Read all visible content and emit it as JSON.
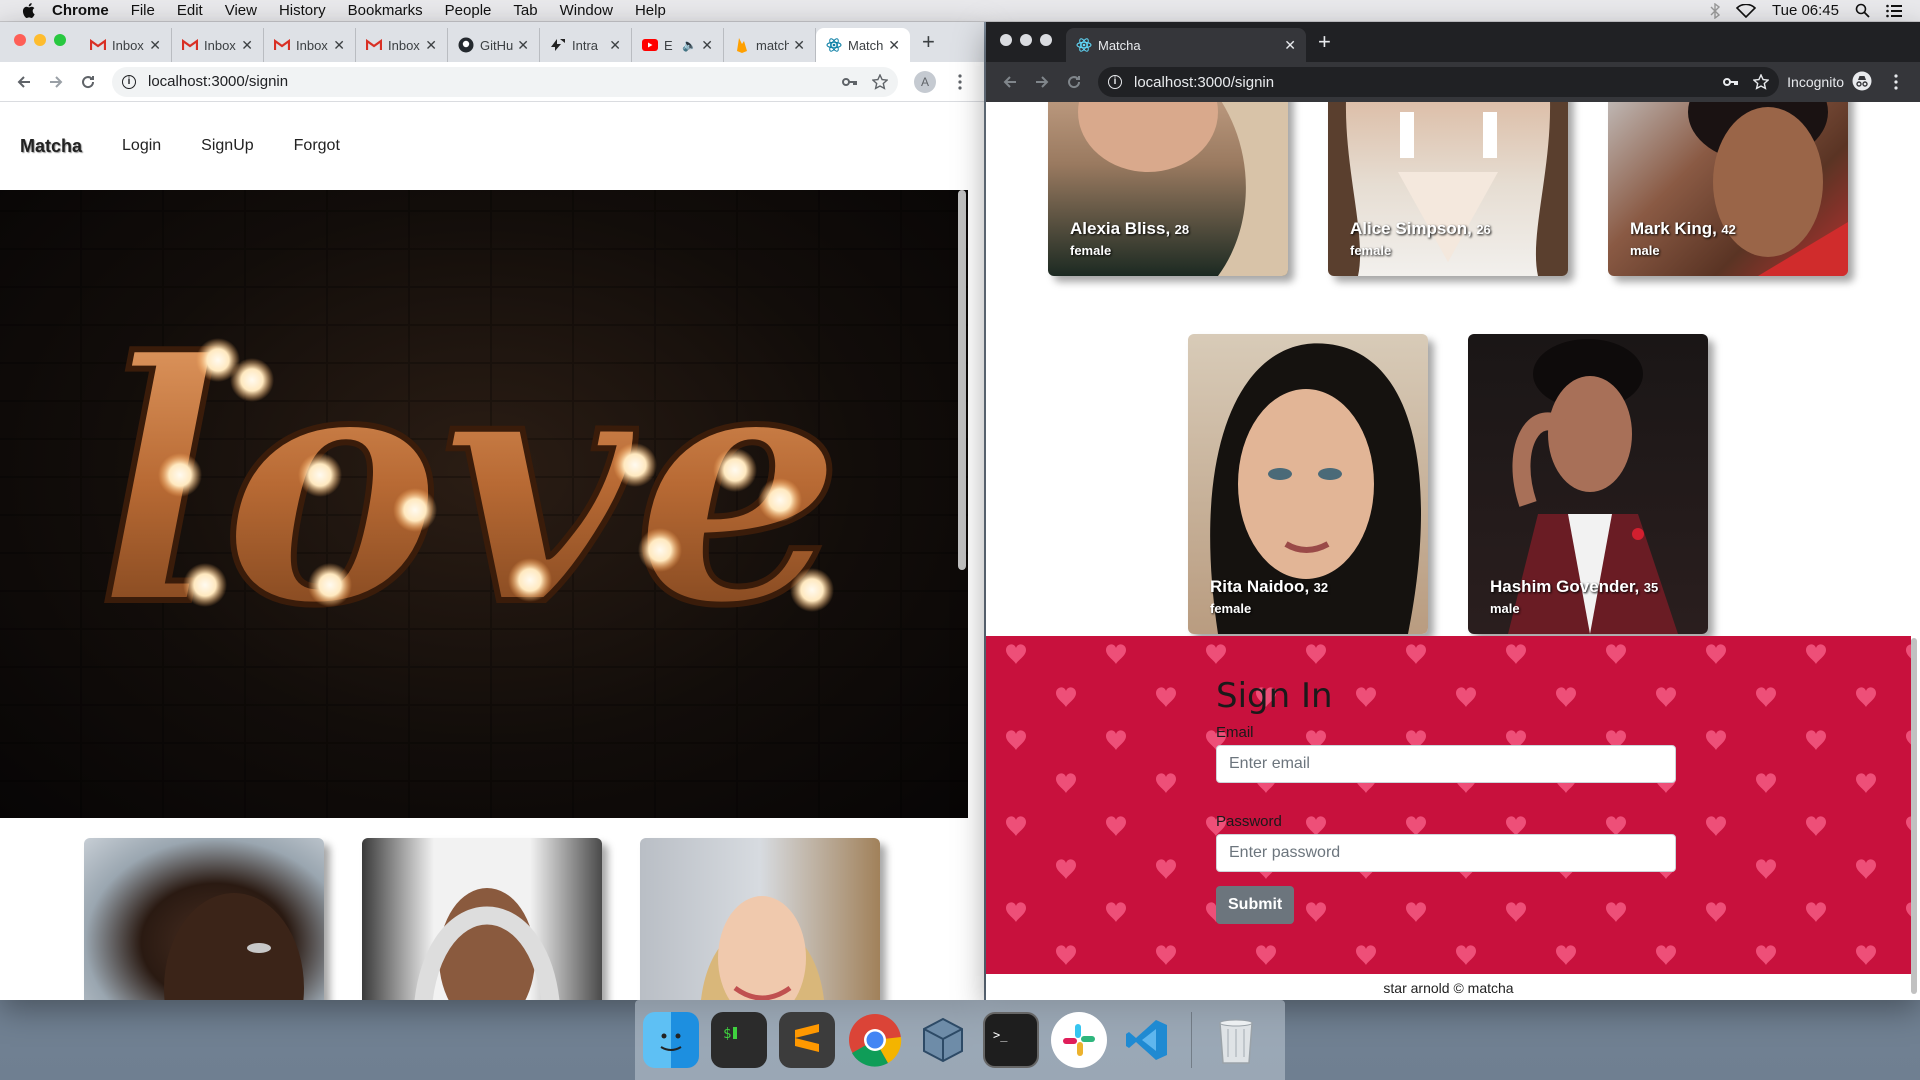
{
  "menubar": {
    "app_name": "Chrome",
    "items": [
      "File",
      "Edit",
      "View",
      "History",
      "Bookmarks",
      "People",
      "Tab",
      "Window",
      "Help"
    ],
    "clock": "Tue 06:45"
  },
  "left_window": {
    "tabs": [
      {
        "title": "Inbox",
        "icon": "gmail-icon"
      },
      {
        "title": "Inbox",
        "icon": "gmail-icon"
      },
      {
        "title": "Inbox",
        "icon": "gmail-icon"
      },
      {
        "title": "Inbox",
        "icon": "gmail-icon"
      },
      {
        "title": "GitHub",
        "icon": "github-icon"
      },
      {
        "title": "Intra",
        "icon": "intra-icon"
      },
      {
        "title": "E",
        "icon": "youtube-icon"
      },
      {
        "title": "matcha",
        "icon": "firebase-icon"
      },
      {
        "title": "Matcha",
        "icon": "react-icon",
        "active": true
      }
    ],
    "url": "localhost:3000/signin",
    "profile_letter": "A"
  },
  "right_window": {
    "tab_title": "Matcha",
    "url": "localhost:3000/signin",
    "incognito_label": "Incognito"
  },
  "site": {
    "brand": "Matcha",
    "nav": [
      "Login",
      "SignUp",
      "Forgot"
    ],
    "hero_word": "love"
  },
  "profiles_top": [
    {
      "name": "Alexia Bliss,",
      "age": "28",
      "gender": "female"
    },
    {
      "name": "Alice Simpson,",
      "age": "26",
      "gender": "female"
    },
    {
      "name": "Mark King,",
      "age": "42",
      "gender": "male"
    }
  ],
  "profiles_bottom": [
    {
      "name": "Rita Naidoo,",
      "age": "32",
      "gender": "female"
    },
    {
      "name": "Hashim Govender,",
      "age": "35",
      "gender": "male"
    }
  ],
  "signin": {
    "title": "Sign In",
    "email_label": "Email",
    "email_placeholder": "Enter email",
    "password_label": "Password",
    "password_placeholder": "Enter password",
    "submit_label": "Submit"
  },
  "footer": "star arnold © matcha",
  "colors": {
    "signin_bg": "#c8113d",
    "heart": "#ee4f78"
  }
}
